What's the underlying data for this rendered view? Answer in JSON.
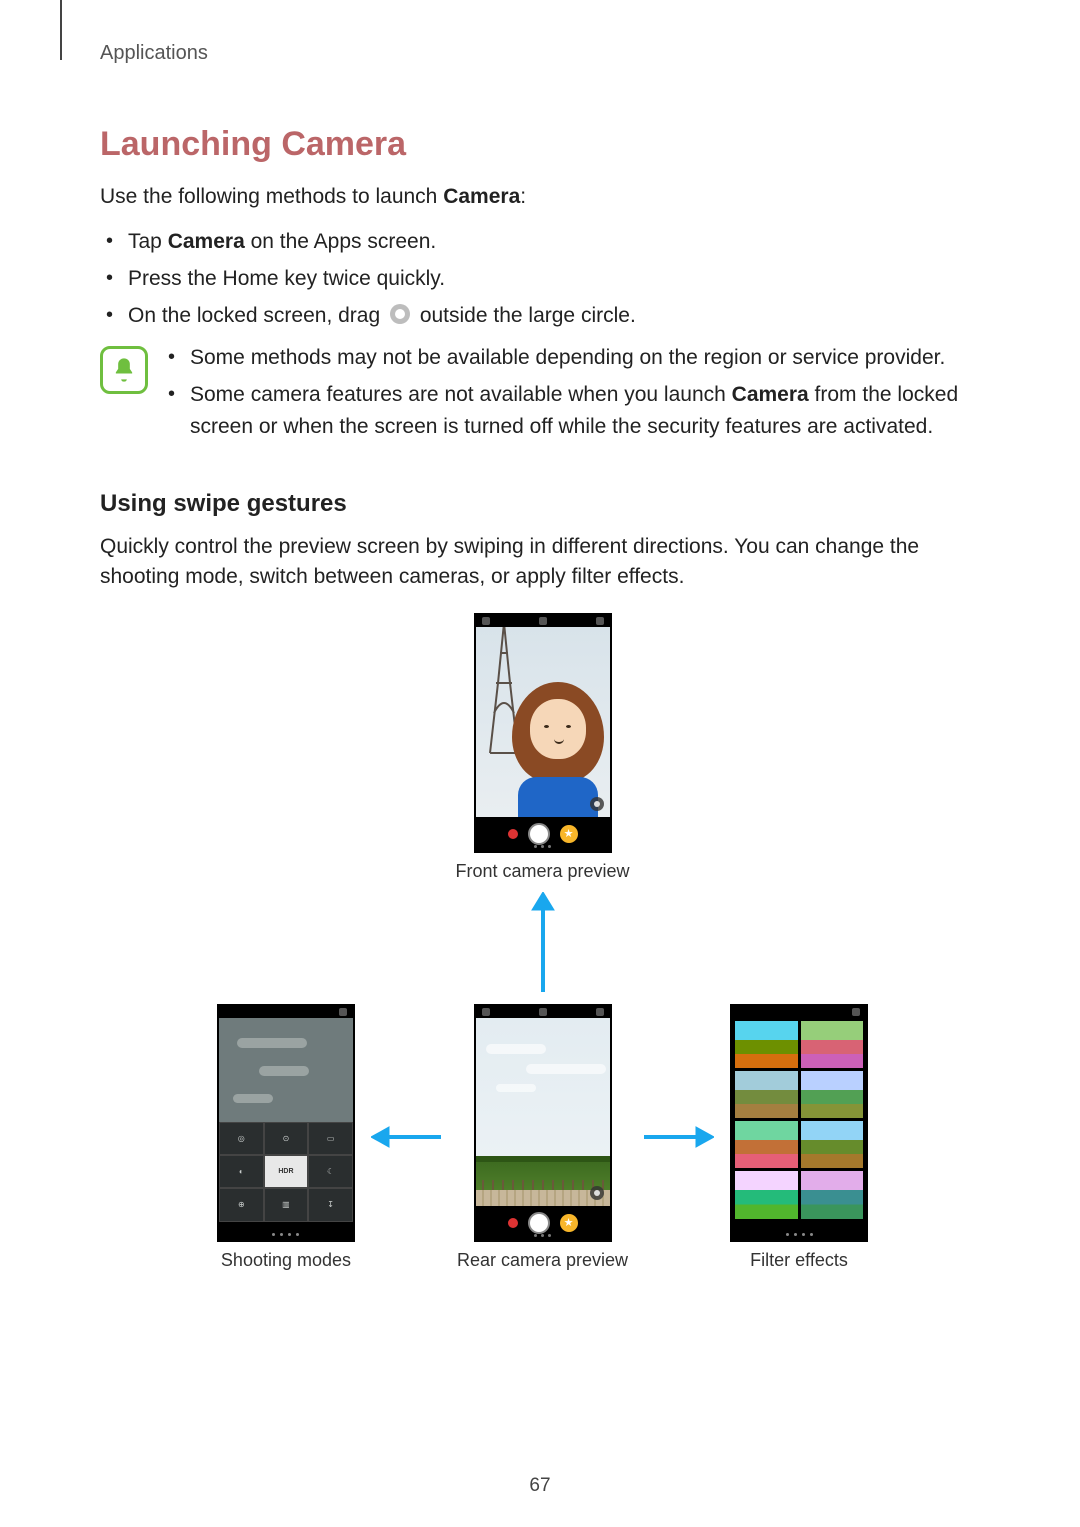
{
  "header": "Applications",
  "title": "Launching Camera",
  "intro_prefix": "Use the following methods to launch ",
  "intro_bold": "Camera",
  "intro_suffix": ":",
  "methods": {
    "m1_prefix": "Tap ",
    "m1_bold": "Camera",
    "m1_suffix": " on the Apps screen.",
    "m2": "Press the Home key twice quickly.",
    "m3_prefix": "On the locked screen, drag ",
    "m3_suffix": " outside the large circle."
  },
  "notes": {
    "n1": "Some methods may not be available depending on the region or service provider.",
    "n2_prefix": "Some camera features are not available when you launch ",
    "n2_bold": "Camera",
    "n2_suffix": " from the locked screen or when the screen is turned off while the security features are activated."
  },
  "swipe": {
    "heading": "Using swipe gestures",
    "body": "Quickly control the preview screen by swiping in different directions. You can change the shooting mode, switch between cameras, or apply filter effects."
  },
  "captions": {
    "front": "Front camera preview",
    "rear": "Rear camera preview",
    "left": "Shooting modes",
    "right": "Filter effects"
  },
  "modes_panel": {
    "hdr": "HDR"
  },
  "page_number": "67"
}
